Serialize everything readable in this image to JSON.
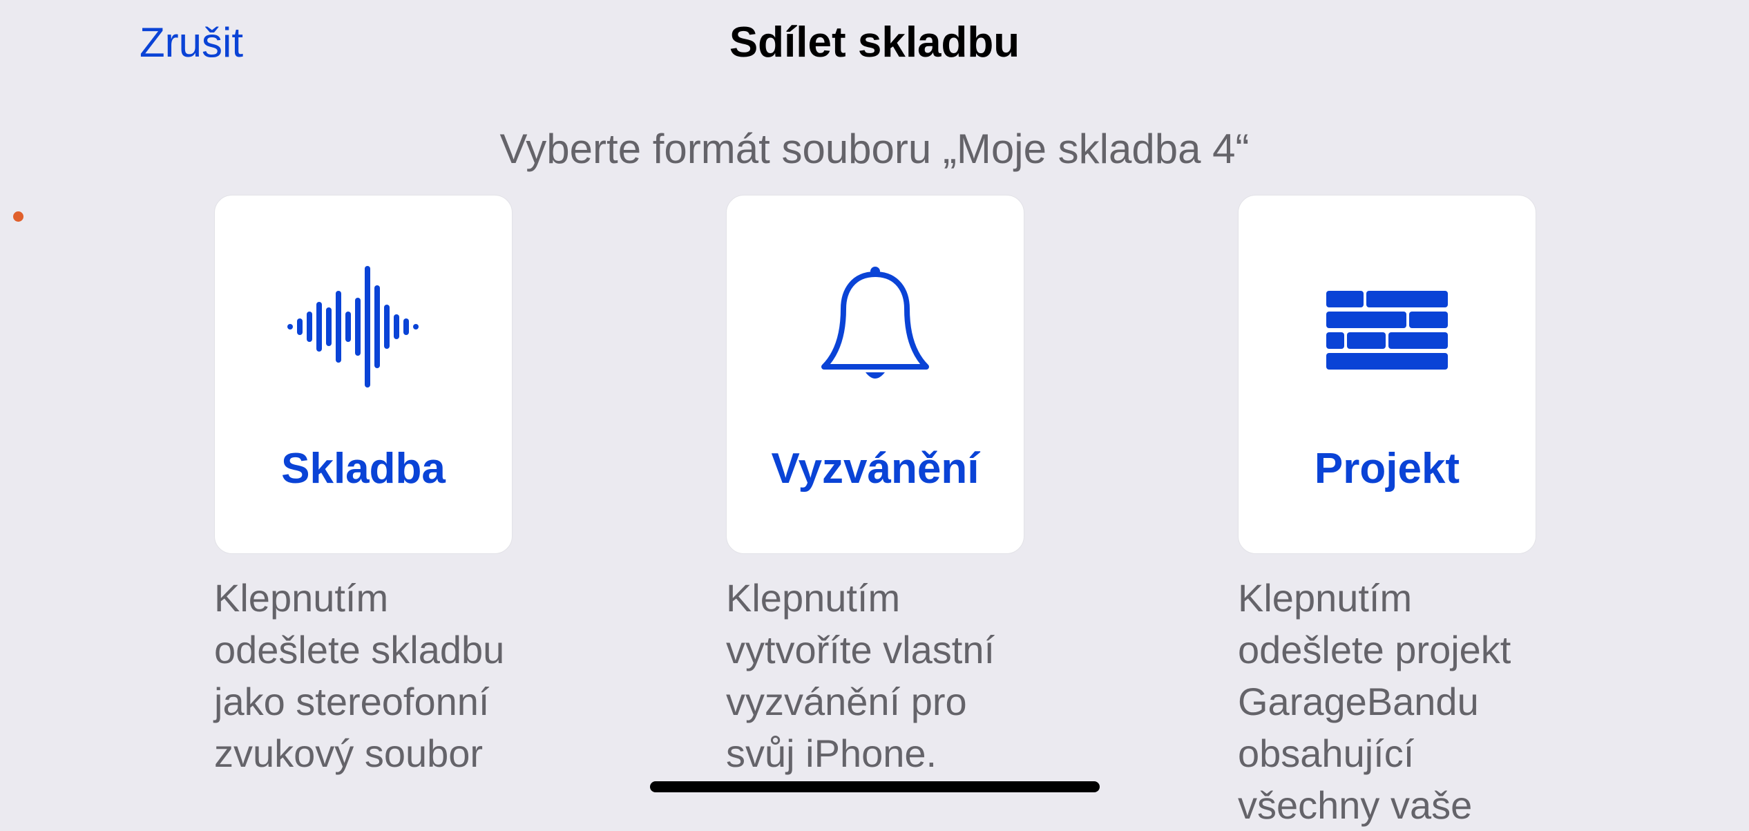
{
  "header": {
    "cancel_label": "Zrušit",
    "title": "Sdílet skladbu"
  },
  "prompt": "Vyberte formát souboru „Moje skladba 4“",
  "options": [
    {
      "label": "Skladba",
      "icon": "waveform-icon",
      "description": "Klepnutím odešlete skladbu jako stereofonní zvukový soubor"
    },
    {
      "label": "Vyzvánění",
      "icon": "bell-icon",
      "description": "Klepnutím vytvoříte vlastní vyzvánění pro svůj iPhone."
    },
    {
      "label": "Projekt",
      "icon": "brick-wall-icon",
      "description": "Klepnutím odešlete projekt GarageBandu obsahující všechny vaše"
    }
  ],
  "colors": {
    "accent": "#0a43d6",
    "background": "#ebeaf0",
    "card": "#ffffff",
    "secondary_text": "#646369"
  }
}
